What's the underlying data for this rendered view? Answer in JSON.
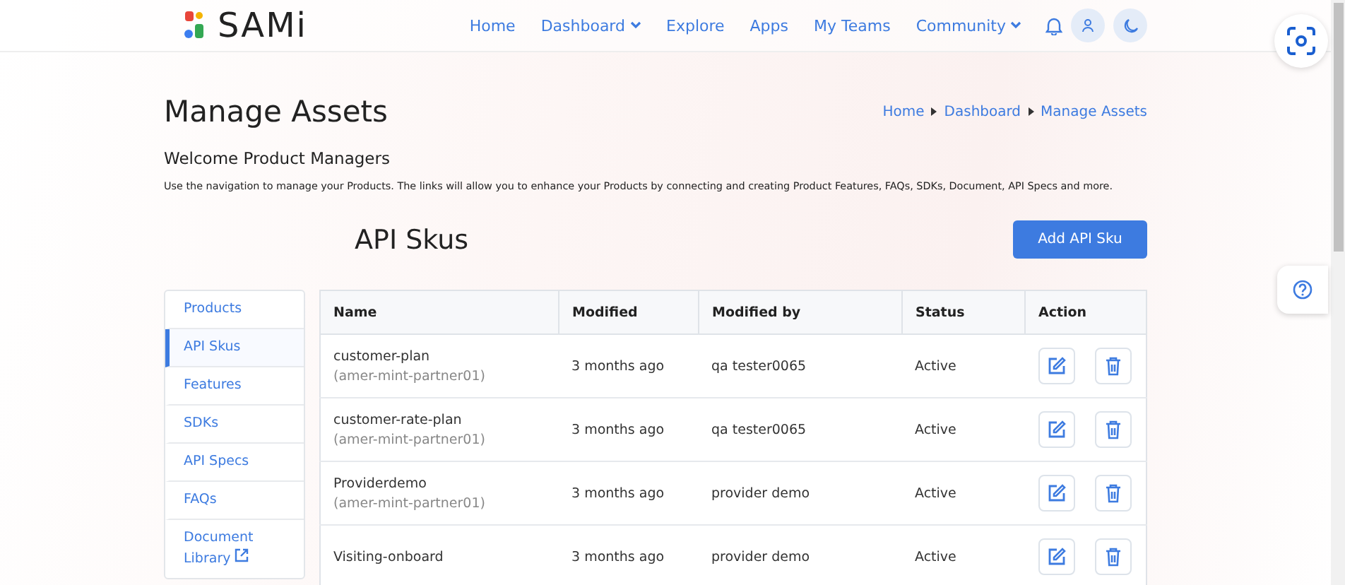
{
  "header": {
    "logo": "SAMi",
    "nav": [
      {
        "label": "Home",
        "dropdown": false
      },
      {
        "label": "Dashboard",
        "dropdown": true
      },
      {
        "label": "Explore",
        "dropdown": false
      },
      {
        "label": "Apps",
        "dropdown": false
      },
      {
        "label": "My Teams",
        "dropdown": false
      },
      {
        "label": "Community",
        "dropdown": true
      }
    ]
  },
  "page": {
    "title": "Manage Assets",
    "breadcrumb": [
      "Home",
      "Dashboard",
      "Manage Assets"
    ],
    "welcome": "Welcome Product Managers",
    "description": "Use the navigation to manage your Products. The links will allow you to enhance your Products by connecting and creating Product Features, FAQs, SDKs, Document, API Specs and more."
  },
  "section": {
    "title": "API Skus",
    "add_button": "Add API Sku"
  },
  "sidebar": {
    "items": [
      {
        "label": "Products",
        "selected": false,
        "external": false
      },
      {
        "label": "API Skus",
        "selected": true,
        "external": false
      },
      {
        "label": "Features",
        "selected": false,
        "external": false
      },
      {
        "label": "SDKs",
        "selected": false,
        "external": false
      },
      {
        "label": "API Specs",
        "selected": false,
        "external": false
      },
      {
        "label": "FAQs",
        "selected": false,
        "external": false
      },
      {
        "label": "Document Library",
        "selected": false,
        "external": true
      }
    ]
  },
  "table": {
    "columns": [
      "Name",
      "Modified",
      "Modified by",
      "Status",
      "Action"
    ],
    "rows": [
      {
        "name": "customer-plan",
        "account": "(amer-mint-partner01)",
        "modified": "3 months ago",
        "modified_by": "qa tester0065",
        "status": "Active"
      },
      {
        "name": "customer-rate-plan",
        "account": "(amer-mint-partner01)",
        "modified": "3 months ago",
        "modified_by": "qa tester0065",
        "status": "Active"
      },
      {
        "name": "Providerdemo",
        "account": "(amer-mint-partner01)",
        "modified": "3 months ago",
        "modified_by": "provider demo",
        "status": "Active"
      },
      {
        "name": "Visiting-onboard",
        "modified": "3 months ago",
        "modified_by": "provider demo",
        "status": "Active"
      }
    ]
  }
}
